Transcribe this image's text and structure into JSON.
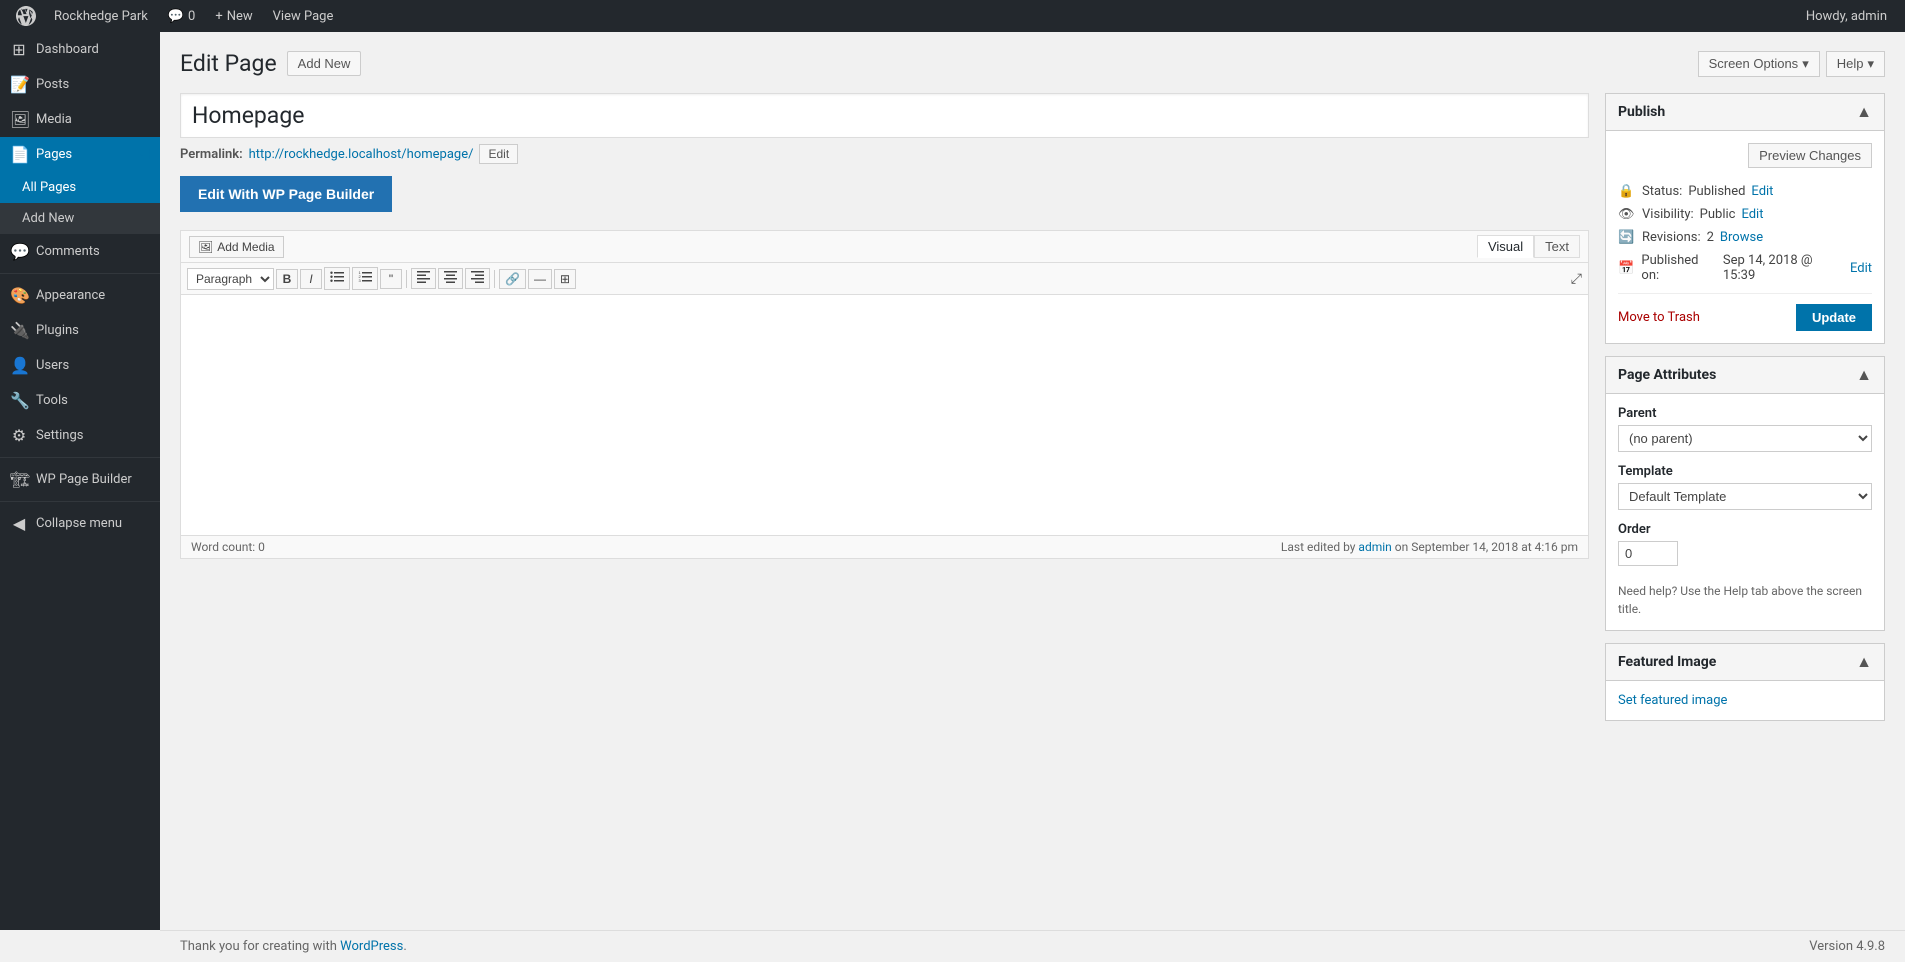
{
  "adminbar": {
    "site_name": "Rockhedge Park",
    "comment_count": "0",
    "new_label": "New",
    "view_page_label": "View Page",
    "howdy": "Howdy, admin"
  },
  "top_buttons": {
    "screen_options": "Screen Options",
    "help": "Help"
  },
  "sidebar": {
    "items": [
      {
        "id": "dashboard",
        "label": "Dashboard",
        "icon": "⊞"
      },
      {
        "id": "posts",
        "label": "Posts",
        "icon": "📝"
      },
      {
        "id": "media",
        "label": "Media",
        "icon": "🖼"
      },
      {
        "id": "pages",
        "label": "Pages",
        "icon": "📄",
        "active": true,
        "has_arrow": true
      },
      {
        "id": "comments",
        "label": "Comments",
        "icon": "💬"
      },
      {
        "id": "appearance",
        "label": "Appearance",
        "icon": "🎨"
      },
      {
        "id": "plugins",
        "label": "Plugins",
        "icon": "🔌"
      },
      {
        "id": "users",
        "label": "Users",
        "icon": "👤"
      },
      {
        "id": "tools",
        "label": "Tools",
        "icon": "🔧"
      },
      {
        "id": "settings",
        "label": "Settings",
        "icon": "⚙"
      },
      {
        "id": "wp-page-builder",
        "label": "WP Page Builder",
        "icon": "🏗"
      },
      {
        "id": "collapse",
        "label": "Collapse menu",
        "icon": "◀"
      }
    ],
    "pages_submenu": [
      {
        "id": "all-pages",
        "label": "All Pages",
        "active": true
      },
      {
        "id": "add-new",
        "label": "Add New"
      }
    ]
  },
  "page": {
    "title": "Edit Page",
    "add_new_label": "Add New"
  },
  "editor": {
    "title_value": "Homepage",
    "permalink_label": "Permalink:",
    "permalink_url": "http://rockhedge.localhost/homepage/",
    "permalink_edit_label": "Edit",
    "wp_builder_btn": "Edit With WP Page Builder",
    "add_media_label": "Add Media",
    "tab_visual": "Visual",
    "tab_text": "Text",
    "paragraph_option": "Paragraph",
    "format_bold": "B",
    "format_italic": "I",
    "format_ul": "≡",
    "format_ol": "≡",
    "format_blockquote": "❝",
    "format_align_left": "≡",
    "format_align_center": "≡",
    "format_align_right": "≡",
    "format_link": "🔗",
    "format_more": "…",
    "format_table": "⊞",
    "word_count_label": "Word count: 0",
    "last_edited": "Last edited by",
    "last_edited_user": "admin",
    "last_edited_on": "on September 14, 2018 at 4:16 pm"
  },
  "publish_panel": {
    "title": "Publish",
    "preview_changes_label": "Preview Changes",
    "status_label": "Status:",
    "status_value": "Published",
    "status_edit": "Edit",
    "visibility_label": "Visibility:",
    "visibility_value": "Public",
    "visibility_edit": "Edit",
    "revisions_label": "Revisions:",
    "revisions_count": "2",
    "revisions_browse": "Browse",
    "published_on_label": "Published on:",
    "published_on_value": "Sep 14, 2018 @ 15:39",
    "published_on_edit": "Edit",
    "move_to_trash": "Move to Trash",
    "update_label": "Update"
  },
  "page_attributes": {
    "title": "Page Attributes",
    "parent_label": "Parent",
    "parent_value": "(no parent)",
    "template_label": "Template",
    "template_value": "Default Template",
    "order_label": "Order",
    "order_value": "0",
    "help_text": "Need help? Use the Help tab above the screen title."
  },
  "featured_image": {
    "title": "Featured Image",
    "set_label": "Set featured image"
  },
  "footer": {
    "thank_you": "Thank you for creating with",
    "wordpress_label": "WordPress",
    "version": "Version 4.9.8"
  }
}
